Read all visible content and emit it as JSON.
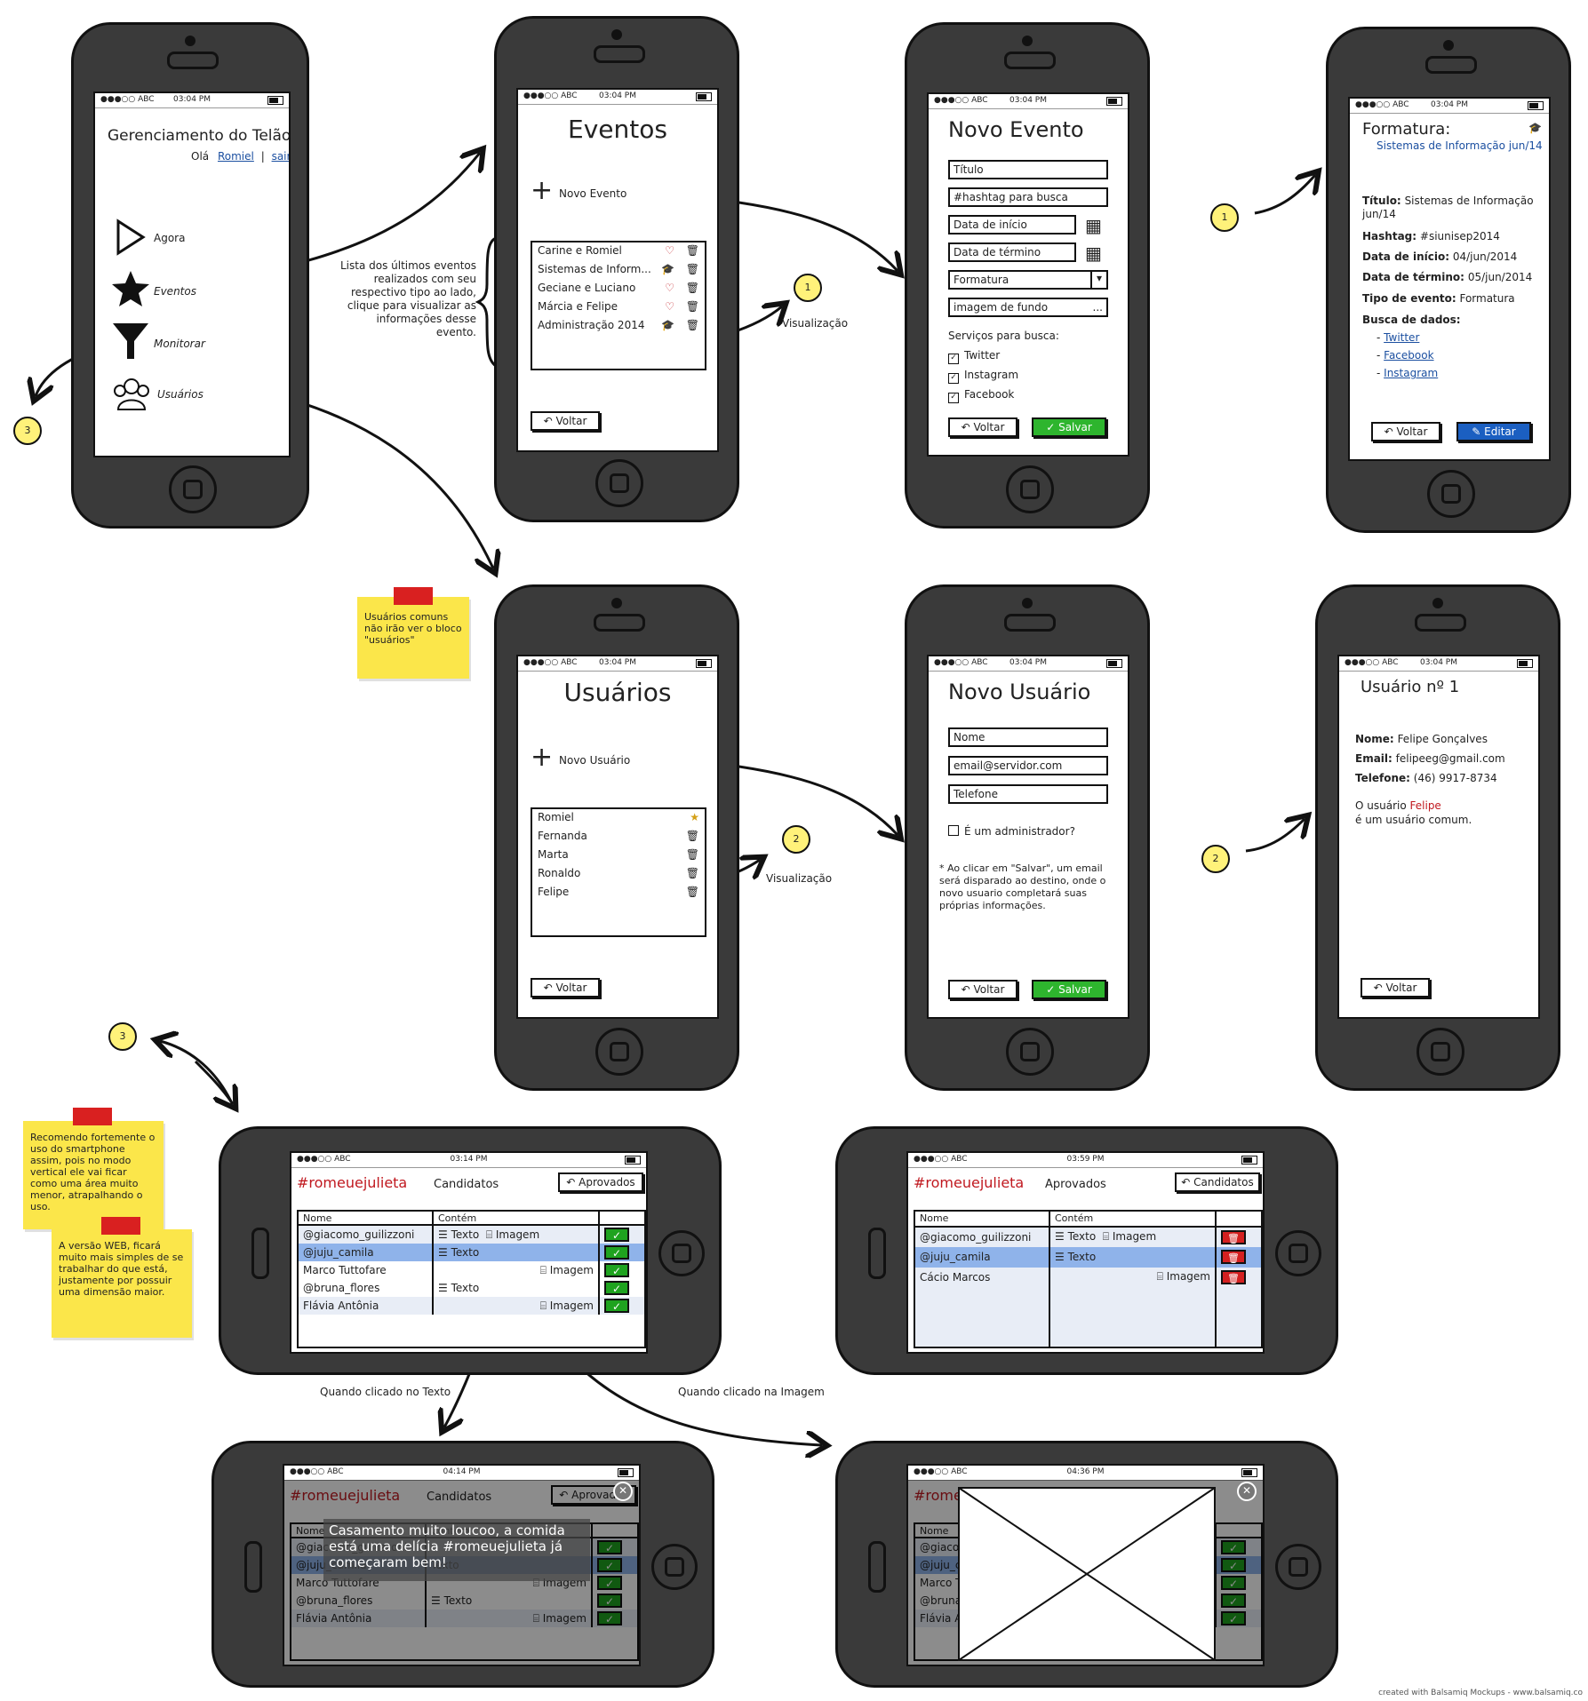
{
  "status": {
    "carrier": "●●●○○ ABC",
    "time_a": "03:04 PM",
    "time_b": "03:14 PM",
    "time_c": "03:59 PM",
    "time_d": "04:14 PM",
    "time_e": "04:36 PM"
  },
  "home": {
    "title": "Gerenciamento do Telão",
    "greeting": "Olá",
    "user_link": "Romiel",
    "separator": "|",
    "logout_link": "sair",
    "menu": [
      {
        "label": "Agora",
        "icon": "play-icon"
      },
      {
        "label": "Eventos",
        "icon": "star-icon"
      },
      {
        "label": "Monitorar",
        "icon": "funnel-icon"
      },
      {
        "label": "Usuários",
        "icon": "users-icon"
      }
    ]
  },
  "events": {
    "title": "Eventos",
    "new_label": "Novo Evento",
    "items": [
      "Carine e Romiel",
      "Sistemas de Inform...",
      "Geciane e Luciano",
      "Márcia e Felipe",
      "Administração 2014"
    ],
    "back": "Voltar",
    "annotation": "Lista dos últimos eventos realizados com seu respectivo tipo ao lado, clique para visualizar as informações desse evento.",
    "view_label": "Visualização"
  },
  "new_event": {
    "title": "Novo Evento",
    "fields": [
      "Título",
      "#hashtag para busca",
      "Data de início",
      "Data de término",
      "Formatura",
      "imagem de fundo"
    ],
    "browse": "...",
    "services_label": "Serviços para busca:",
    "services": [
      "Twitter",
      "Instagram",
      "Facebook"
    ],
    "back": "Voltar",
    "save": "Salvar"
  },
  "event_detail": {
    "title": "Formatura:",
    "subtitle": "Sistemas de Informação jun/14",
    "rows": [
      {
        "k": "Título:",
        "v": "Sistemas de Informação jun/14"
      },
      {
        "k": "Hashtag:",
        "v": "#siunisep2014"
      },
      {
        "k": "Data de início:",
        "v": "04/jun/2014"
      },
      {
        "k": "Data de término:",
        "v": "05/jun/2014"
      },
      {
        "k": "Tipo de evento:",
        "v": "Formatura"
      }
    ],
    "sources_label": "Busca de dados:",
    "sources": [
      "Twitter",
      "Facebook",
      "Instagram"
    ],
    "back": "Voltar",
    "edit": "Editar"
  },
  "users": {
    "title": "Usuários",
    "new_label": "Novo Usuário",
    "items": [
      "Romiel",
      "Fernanda",
      "Marta",
      "Ronaldo",
      "Felipe"
    ],
    "back": "Voltar",
    "note": "Usuários comuns não irão ver o bloco \"usuários\"",
    "view_label": "Visualização"
  },
  "new_user": {
    "title": "Novo Usuário",
    "fields": [
      "Nome",
      "email@servidor.com",
      "Telefone"
    ],
    "admin_label": "É um administrador?",
    "hint": "* Ao clicar em \"Salvar\", um email será disparado ao destino, onde o novo usuario completará suas próprias informações.",
    "back": "Voltar",
    "save": "Salvar"
  },
  "user_detail": {
    "title": "Usuário nº 1",
    "rows": [
      {
        "k": "Nome:",
        "v": "Felipe Gonçalves"
      },
      {
        "k": "Email:",
        "v": "felipeeg@gmail.com"
      },
      {
        "k": "Telefone:",
        "v": "(46) 9917-8734"
      }
    ],
    "status_prefix": "O usuário",
    "status_name": "Felipe",
    "status_suffix": "é um usuário comum.",
    "back": "Voltar"
  },
  "candidates": {
    "app": "#romeuejulieta",
    "title": "Candidatos",
    "switch": "Aprovados",
    "col_name": "Nome",
    "col_content": "Contém",
    "rows": [
      {
        "name": "@giacomo_guilizzoni",
        "text": "Texto",
        "image": "Imagem"
      },
      {
        "name": "@juju_camila",
        "text": "Texto",
        "image": ""
      },
      {
        "name": "Marco Tuttofare",
        "text": "",
        "image": "Imagem"
      },
      {
        "name": "@bruna_flores",
        "text": "Texto",
        "image": ""
      },
      {
        "name": "Flávia Antônia",
        "text": "",
        "image": "Imagem"
      }
    ]
  },
  "approved": {
    "app": "#romeuejulieta",
    "title": "Aprovados",
    "switch": "Candidatos",
    "rows": [
      {
        "name": "@giacomo_guilizzoni",
        "text": "Texto",
        "image": "Imagem"
      },
      {
        "name": "@juju_camila",
        "text": "Texto",
        "image": ""
      },
      {
        "name": "Cácio Marcos",
        "text": "",
        "image": "Imagem"
      }
    ]
  },
  "text_popup": {
    "message": "Casamento muito loucoo, a comida está uma delícia #romeuejulieta já começaram bem!",
    "caption": "Quando clicado no Texto"
  },
  "image_popup": {
    "caption": "Quando clicado na Imagem"
  },
  "notes": {
    "smartphone": "Recomendo fortemente o uso do smartphone assim, pois no modo vertical ele vai ficar como uma área muito menor, atrapalhando o uso.",
    "web": "A versão WEB, ficará muito mais simples de se trabalhar do que está, justamente por possuir uma dimensão maior."
  },
  "markers": [
    "1",
    "2",
    "3"
  ],
  "footer": "created with Balsamiq Mockups - www.balsamiq.co",
  "colors": {
    "accent_red": "#c0181f",
    "link_blue": "#1b4fa0",
    "save_green": "#2eb52e",
    "sticky": "#fbe64a"
  }
}
